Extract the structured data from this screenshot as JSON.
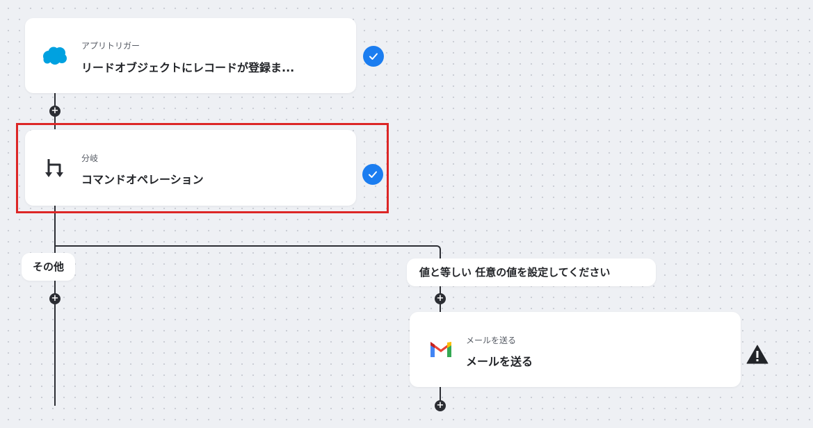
{
  "steps": [
    {
      "type_label": "アプリトリガー",
      "title": "リードオブジェクトにレコードが登録ま...",
      "icon": "salesforce-cloud-icon",
      "status": "complete"
    },
    {
      "type_label": "分岐",
      "title": "コマンドオペレーション",
      "icon": "branch-icon",
      "status": "complete",
      "highlighted": true
    }
  ],
  "branches": {
    "other_label": "その他",
    "condition_label": "値と等しい 任意の値を設定してください"
  },
  "email_step": {
    "type_label": "メールを送る",
    "title": "メールを送る",
    "icon": "gmail-icon",
    "status": "warning"
  },
  "colors": {
    "accent": "#1b7df0",
    "highlight_border": "#dc2626",
    "connector": "#2b2d33",
    "salesforce": "#00a1e0"
  }
}
